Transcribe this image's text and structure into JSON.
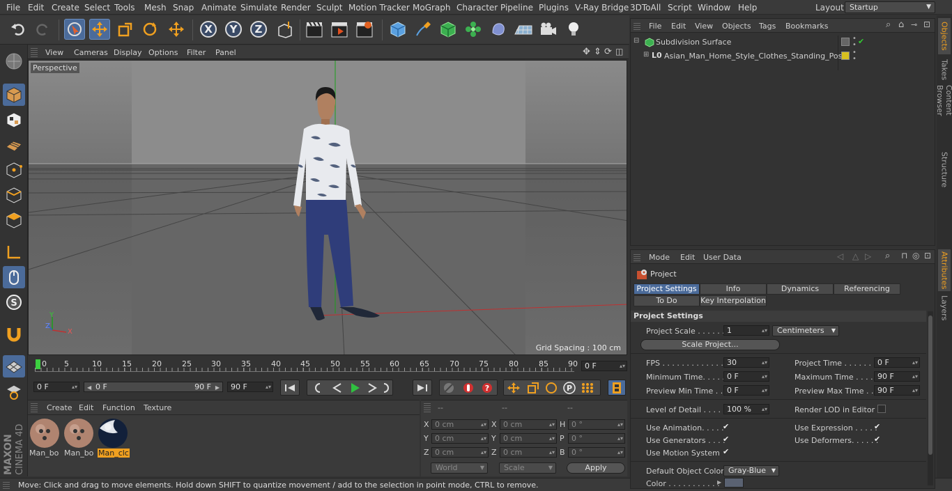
{
  "menu": [
    "File",
    "Edit",
    "Create",
    "Select",
    "Tools",
    "Mesh",
    "Snap",
    "Animate",
    "Simulate",
    "Render",
    "Sculpt",
    "Motion Tracker",
    "MoGraph",
    "Character",
    "Pipeline",
    "Plugins",
    "V-Ray Bridge",
    "3DToAll",
    "Script",
    "Window",
    "Help"
  ],
  "layout": {
    "label": "Layout:",
    "value": "Startup"
  },
  "viewport": {
    "menu": [
      "View",
      "Cameras",
      "Display",
      "Options",
      "Filter",
      "Panel"
    ],
    "label": "Perspective",
    "grid_spacing": "Grid Spacing : 100 cm",
    "axis_x": "X",
    "axis_y": "Y",
    "axis_z": "Z"
  },
  "timeline": {
    "ticks": [
      "0",
      "5",
      "10",
      "15",
      "20",
      "25",
      "30",
      "35",
      "40",
      "45",
      "50",
      "55",
      "60",
      "65",
      "70",
      "75",
      "80",
      "85",
      "90"
    ],
    "current_frame": "0 F",
    "start": "0 F",
    "range_start": "0 F",
    "range_end": "90 F",
    "end": "90 F"
  },
  "materials": {
    "menu": [
      "Create",
      "Edit",
      "Function",
      "Texture"
    ],
    "items": [
      "Man_bo",
      "Man_bo",
      "Man_clc"
    ]
  },
  "coords": {
    "headers": [
      "--",
      "--",
      "--"
    ],
    "rows": [
      {
        "a": "X",
        "av": "0 cm",
        "b": "X",
        "bv": "0 cm",
        "c": "H",
        "cv": "0 °"
      },
      {
        "a": "Y",
        "av": "0 cm",
        "b": "Y",
        "bv": "0 cm",
        "c": "P",
        "cv": "0 °"
      },
      {
        "a": "Z",
        "av": "0 cm",
        "b": "Z",
        "bv": "0 cm",
        "c": "B",
        "cv": "0 °"
      }
    ],
    "space": "World",
    "mode": "Scale",
    "apply": "Apply"
  },
  "status": "Move: Click and drag to move elements. Hold down SHIFT to quantize movement / add to the selection in point mode, CTRL to remove.",
  "objects": {
    "menu": [
      "File",
      "Edit",
      "View",
      "Objects",
      "Tags",
      "Bookmarks"
    ],
    "items": [
      "Subdivision Surface",
      "Asian_Man_Home_Style_Clothes_Standing_Pose"
    ]
  },
  "attributes": {
    "menu": [
      "Mode",
      "Edit",
      "User Data"
    ],
    "title": "Project",
    "tabs_row1": [
      "Project Settings",
      "Info",
      "Dynamics",
      "Referencing"
    ],
    "tabs_row2": [
      "To Do",
      "Key Interpolation"
    ],
    "section": "Project Settings",
    "project_scale_label": "Project Scale . . . . . .",
    "project_scale": "1",
    "project_scale_unit": "Centimeters",
    "scale_project": "Scale Project...",
    "fps_label": "FPS . . . . . . . . . . . . . .",
    "fps": "30",
    "project_time_label": "Project Time . . . . . . . .",
    "project_time": "0 F",
    "min_time_label": "Minimum Time. . . . . .",
    "min_time": "0 F",
    "max_time_label": "Maximum Time . . . . .",
    "max_time": "90 F",
    "prev_min_label": "Preview Min Time . .",
    "prev_min": "0 F",
    "prev_max_label": "Preview Max Time . . .",
    "prev_max": "90 F",
    "lod_label": "Level of Detail . . . . .",
    "lod": "100 %",
    "render_lod_label": "Render LOD in Editor",
    "use_animation": "Use Animation. . . . .",
    "use_expression": "Use Expression . . . . .",
    "use_generators": "Use Generators . . . .",
    "use_deformers": "Use Deformers. . . . . .",
    "use_motion": "Use Motion System",
    "default_color_label": "Default Object Color",
    "default_color": "Gray-Blue",
    "color_label": "Color . . . . . . . . . . ."
  },
  "side_tabs": [
    "Objects",
    "Takes",
    "Content Browser",
    "Structure",
    "Attributes",
    "Layers"
  ],
  "logo": {
    "line1": "MAXON",
    "line2": "CINEMA 4D"
  }
}
